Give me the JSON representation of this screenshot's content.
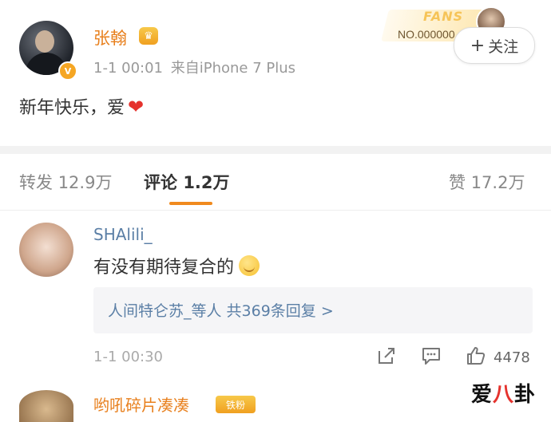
{
  "post": {
    "username": "张翰",
    "timestamp": "1-1 00:01",
    "source_prefix": "来自",
    "source_device": "iPhone 7 Plus",
    "text": "新年快乐，爱",
    "follow_label": "关注",
    "fans_title": "FANS",
    "fans_number": "NO.000000"
  },
  "tabs": {
    "repost_label": "转发",
    "repost_count": "12.9万",
    "comment_label": "评论",
    "comment_count": "1.2万",
    "like_label": "赞",
    "like_count": "17.2万"
  },
  "comment": {
    "username": "SHAlili_",
    "text": "有没有期待复合的",
    "reply_summary": "人间特仑苏_等人 共369条回复 >",
    "timestamp": "1-1 00:30",
    "like_count": "4478"
  },
  "next_comment": {
    "username": "哟吼碎片凑凑",
    "badge": "铁粉"
  },
  "watermark": {
    "left": "爱",
    "mid": "八",
    "right": "卦"
  },
  "colors": {
    "accent": "#f08a1e",
    "username": "#e8801e",
    "link": "#5b7fa6"
  }
}
